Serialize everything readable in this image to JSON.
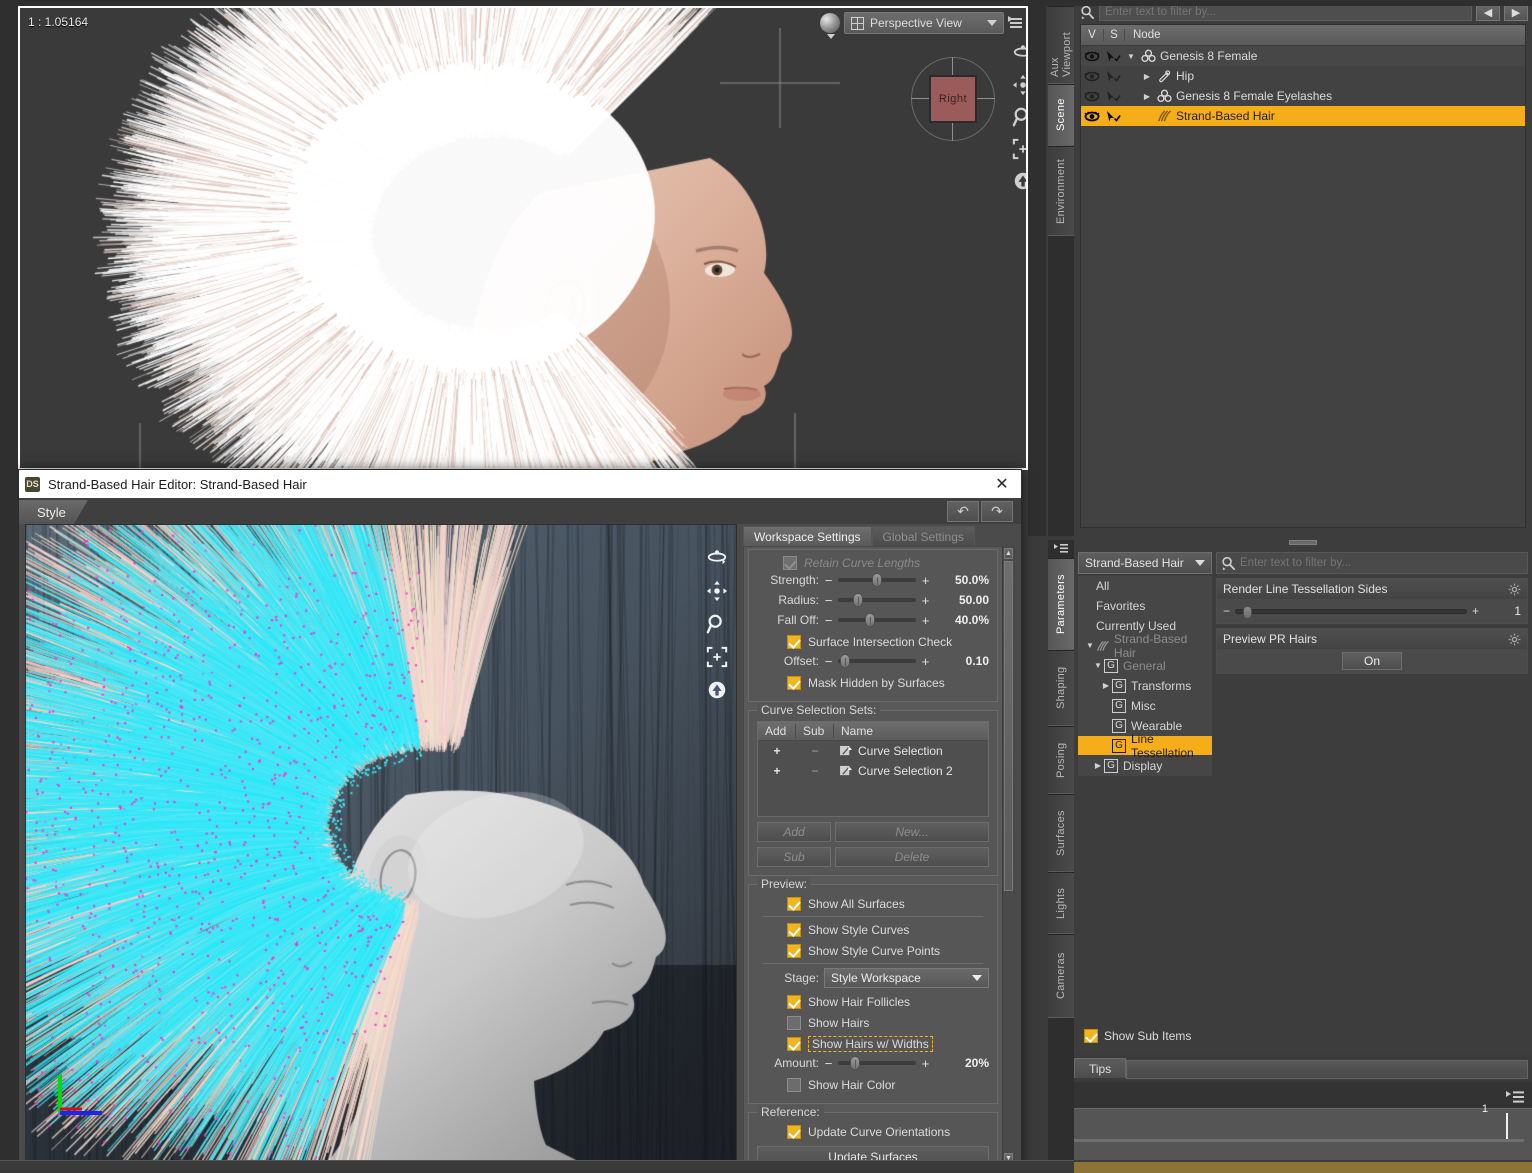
{
  "viewport": {
    "ratio_label": "1 : 1.05164",
    "view_selector": "Perspective View",
    "viewcube_face": "Right",
    "nav_icons": [
      "orbit-icon",
      "pan-icon",
      "zoom-icon",
      "frame-icon",
      "reset-icon"
    ]
  },
  "right_tabs_top": [
    "Aux Viewport",
    "Scene",
    "Environment"
  ],
  "right_tabs_bottom": [
    "Parameters",
    "Shaping",
    "Posing",
    "Surfaces",
    "Lights",
    "Cameras"
  ],
  "scene": {
    "filter_placeholder": "Enter text to filter by...",
    "columns": [
      "V",
      "S",
      "Node"
    ],
    "rows": [
      {
        "label": "Genesis 8 Female",
        "indent": 0,
        "twisty": "down",
        "icon": "figure-icon",
        "selected": false
      },
      {
        "label": "Hip",
        "indent": 1,
        "twisty": "right",
        "icon": "bone-icon",
        "selected": false
      },
      {
        "label": "Genesis 8 Female Eyelashes",
        "indent": 1,
        "twisty": "right",
        "icon": "figure-icon",
        "selected": false
      },
      {
        "label": "Strand-Based Hair",
        "indent": 1,
        "twisty": "none",
        "icon": "hair-icon",
        "selected": true
      }
    ]
  },
  "parameters": {
    "combo_value": "Strand-Based Hair",
    "filter_placeholder": "Enter text to filter by...",
    "show_sub_items_label": "Show Sub Items",
    "show_sub_items_checked": true,
    "tree": [
      {
        "label": "All",
        "indent": 0,
        "kind": "plain",
        "twisty": "none",
        "selected": false,
        "dim": false
      },
      {
        "label": "Favorites",
        "indent": 0,
        "kind": "plain",
        "twisty": "none",
        "selected": false,
        "dim": false
      },
      {
        "label": "Currently Used",
        "indent": 0,
        "kind": "plain",
        "twisty": "none",
        "selected": false,
        "dim": false
      },
      {
        "label": "Strand-Based Hair",
        "indent": 0,
        "kind": "hair",
        "twisty": "down",
        "selected": false,
        "dim": true
      },
      {
        "label": "General",
        "indent": 1,
        "kind": "group",
        "twisty": "down",
        "selected": false,
        "dim": true
      },
      {
        "label": "Transforms",
        "indent": 2,
        "kind": "group",
        "twisty": "right",
        "selected": false,
        "dim": false
      },
      {
        "label": "Misc",
        "indent": 2,
        "kind": "group",
        "twisty": "none",
        "selected": false,
        "dim": false
      },
      {
        "label": "Wearable",
        "indent": 2,
        "kind": "group",
        "twisty": "none",
        "selected": false,
        "dim": false
      },
      {
        "label": "Line Tessellation",
        "indent": 2,
        "kind": "group",
        "twisty": "none",
        "selected": true,
        "dim": false
      },
      {
        "label": "Display",
        "indent": 1,
        "kind": "group",
        "twisty": "right",
        "selected": false,
        "dim": false
      }
    ],
    "properties": [
      {
        "name": "Render Line Tessellation Sides",
        "type": "slider",
        "value": "1",
        "fill_pct": 3
      },
      {
        "name": "Preview PR Hairs",
        "type": "toggle",
        "value": "On"
      }
    ]
  },
  "tips": {
    "tab_label": "Tips"
  },
  "timeline": {
    "current_frame": "1"
  },
  "hair_editor": {
    "title": "Strand-Based Hair Editor: Strand-Based Hair",
    "app_badge": "DS",
    "close_glyph": "✕",
    "main_tab": "Style",
    "undo_glyph": "↶",
    "redo_glyph": "↷",
    "sub_tabs": [
      {
        "label": "Workspace Settings",
        "active": true
      },
      {
        "label": "Global Settings",
        "active": false
      }
    ],
    "tool_settings": {
      "retain_curve_lengths": {
        "label": "Retain Curve Lengths",
        "checked": true,
        "disabled": true
      },
      "sliders": [
        {
          "label": "Strength:",
          "value": "50.0%",
          "pct": 50
        },
        {
          "label": "Radius:",
          "value": "50.00",
          "pct": 26
        },
        {
          "label": "Fall Off:",
          "value": "40.0%",
          "pct": 41
        }
      ],
      "surface_intersection_check": {
        "label": "Surface Intersection Check",
        "checked": true
      },
      "offset": {
        "label": "Offset:",
        "value": "0.10",
        "pct": 3
      },
      "mask_hidden_by_surfaces": {
        "label": "Mask Hidden by Surfaces",
        "checked": true
      }
    },
    "curve_selection_sets": {
      "legend": "Curve Selection Sets:",
      "columns": [
        "Add",
        "Sub",
        "Name"
      ],
      "rows": [
        {
          "add": "+",
          "sub": "−",
          "name": "Curve Selection"
        },
        {
          "add": "+",
          "sub": "−",
          "name": "Curve Selection 2"
        }
      ],
      "buttons": [
        {
          "label": "Add",
          "enabled": false
        },
        {
          "label": "New...",
          "enabled": false
        },
        {
          "label": "Sub",
          "enabled": false
        },
        {
          "label": "Delete",
          "enabled": false
        }
      ]
    },
    "preview": {
      "legend": "Preview:",
      "show_all_surfaces": {
        "label": "Show All Surfaces",
        "checked": true
      },
      "show_style_curves": {
        "label": "Show Style Curves",
        "checked": true
      },
      "show_style_curve_points": {
        "label": "Show Style Curve Points",
        "checked": true
      },
      "stage_label": "Stage:",
      "stage_value": "Style Workspace",
      "show_hair_follicles": {
        "label": "Show Hair Follicles",
        "checked": true
      },
      "show_hairs": {
        "label": "Show Hairs",
        "checked": false
      },
      "show_hairs_w_widths": {
        "label": "Show Hairs w/ Widths",
        "checked": true,
        "highlighted": true
      },
      "amount": {
        "label": "Amount:",
        "value": "20%",
        "pct": 22
      },
      "show_hair_color": {
        "label": "Show Hair Color",
        "checked": false
      }
    },
    "reference": {
      "legend": "Reference:",
      "update_curve_orientations": {
        "label": "Update Curve Orientations",
        "checked": true
      },
      "update_surfaces_button": "Update Surfaces"
    },
    "nav_icons": [
      "orbit-icon",
      "pan-icon",
      "zoom-icon",
      "frame-icon",
      "reset-icon"
    ]
  },
  "colors": {
    "accent": "#f5ae19",
    "panel": "#3d3d3d",
    "dialog": "#4b4b4b",
    "hair_bg": "#4c5a68",
    "viewcube": "#9c5b5b"
  }
}
